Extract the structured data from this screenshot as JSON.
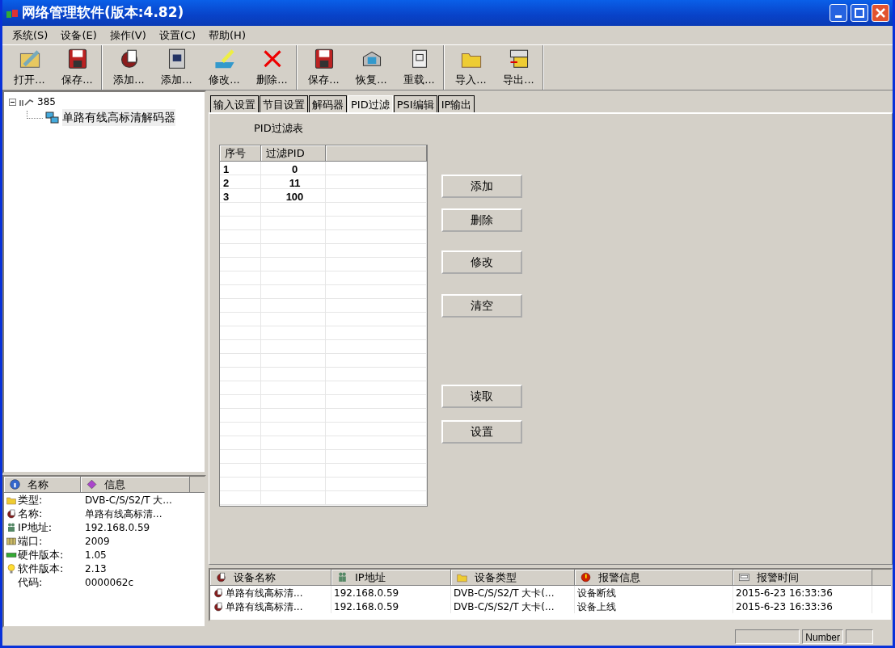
{
  "window": {
    "title": "网络管理软件(版本:4.82)"
  },
  "menu": [
    "系统(S)",
    "设备(E)",
    "操作(V)",
    "设置(C)",
    "帮助(H)"
  ],
  "toolbar": [
    [
      {
        "label": "打开..."
      },
      {
        "label": "保存..."
      }
    ],
    [
      {
        "label": "添加..."
      },
      {
        "label": "添加..."
      },
      {
        "label": "修改..."
      },
      {
        "label": "删除..."
      }
    ],
    [
      {
        "label": "保存..."
      },
      {
        "label": "恢复..."
      },
      {
        "label": "重载..."
      }
    ],
    [
      {
        "label": "导入..."
      },
      {
        "label": "导出..."
      }
    ]
  ],
  "tree": {
    "label": "385",
    "expanded": true,
    "children": [
      {
        "label": "单路有线高标清解码器",
        "selected": true
      }
    ]
  },
  "info": {
    "columns": [
      "名称",
      "信息"
    ],
    "rows": [
      {
        "name": "类型:",
        "value": "DVB-C/S/S2/T 大..."
      },
      {
        "name": "名称:",
        "value": "单路有线高标清..."
      },
      {
        "name": "IP地址:",
        "value": "192.168.0.59"
      },
      {
        "name": "端口:",
        "value": "2009"
      },
      {
        "name": "硬件版本:",
        "value": "1.05"
      },
      {
        "name": "软件版本:",
        "value": "2.13"
      },
      {
        "name": "代码:",
        "value": "0000062c"
      }
    ]
  },
  "tabs": [
    {
      "label": "输入设置",
      "selected": false
    },
    {
      "label": "节目设置",
      "selected": false
    },
    {
      "label": "解码器",
      "selected": false
    },
    {
      "label": "PID过滤",
      "selected": true
    },
    {
      "label": "PSI编辑",
      "selected": false
    },
    {
      "label": "IP输出",
      "selected": false
    }
  ],
  "pid_filter": {
    "title": "PID过滤表",
    "columns": [
      "序号",
      "过滤PID"
    ],
    "rows": [
      [
        "1",
        "0"
      ],
      [
        "2",
        "11"
      ],
      [
        "3",
        "100"
      ]
    ],
    "buttons": [
      "添加",
      "删除",
      "修改",
      "清空",
      "读取",
      "设置"
    ]
  },
  "alarms": {
    "columns": [
      "设备名称",
      "IP地址",
      "设备类型",
      "报警信息",
      "报警时间"
    ],
    "rows": [
      [
        "单路有线高标清...",
        "192.168.0.59",
        "DVB-C/S/S2/T 大卡(...",
        "设备断线",
        "2015-6-23 16:33:36"
      ],
      [
        "单路有线高标清...",
        "192.168.0.59",
        "DVB-C/S/S2/T 大卡(...",
        "设备上线",
        "2015-6-23 16:33:36"
      ]
    ]
  },
  "status_bar": {
    "indicator": "Number"
  }
}
